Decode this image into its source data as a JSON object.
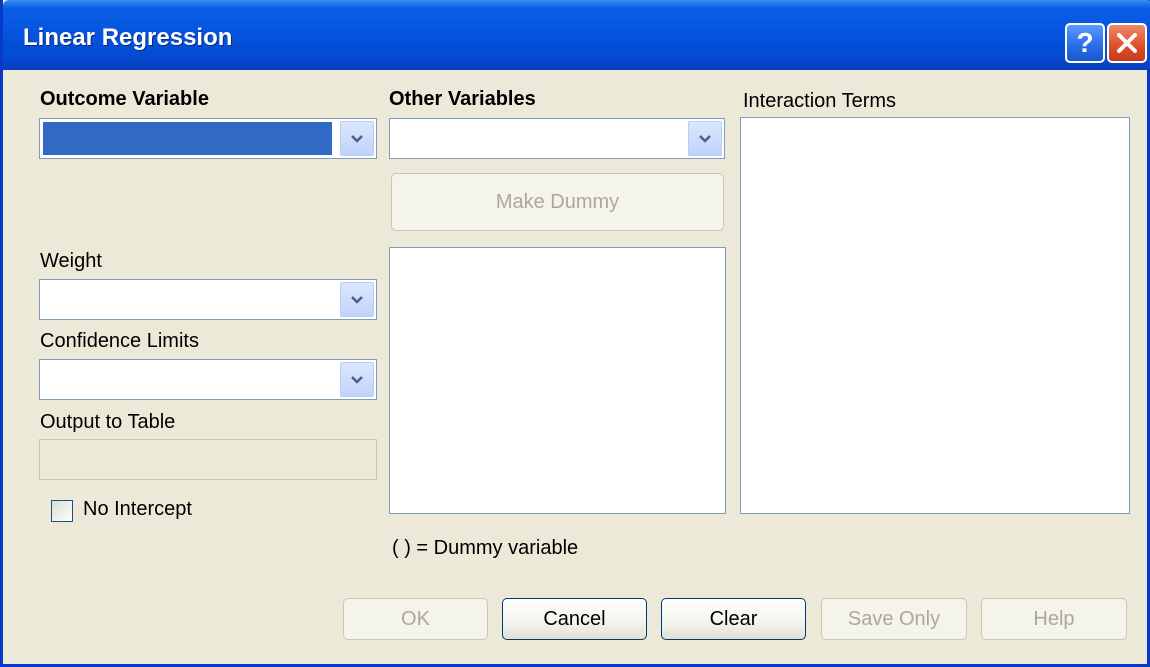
{
  "window": {
    "title": "Linear Regression",
    "help_label": "?"
  },
  "outcome": {
    "label": "Outcome Variable",
    "value": ""
  },
  "weight": {
    "label": "Weight",
    "value": ""
  },
  "confidence": {
    "label": "Confidence Limits",
    "value": ""
  },
  "output_table": {
    "label": "Output to Table",
    "value": ""
  },
  "no_intercept": {
    "label": "No Intercept",
    "checked": false
  },
  "other_vars": {
    "label": "Other Variables",
    "value": "",
    "make_dummy_label": "Make Dummy",
    "dummy_note": "( ) = Dummy variable"
  },
  "interaction": {
    "label": "Interaction Terms"
  },
  "buttons": {
    "ok": "OK",
    "cancel": "Cancel",
    "clear": "Clear",
    "save_only": "Save Only",
    "help": "Help"
  },
  "colors": {
    "titlebar": "#0553dd",
    "dialog_bg": "#ece9d8",
    "selection": "#316ac5",
    "close_button": "#e0522e"
  }
}
